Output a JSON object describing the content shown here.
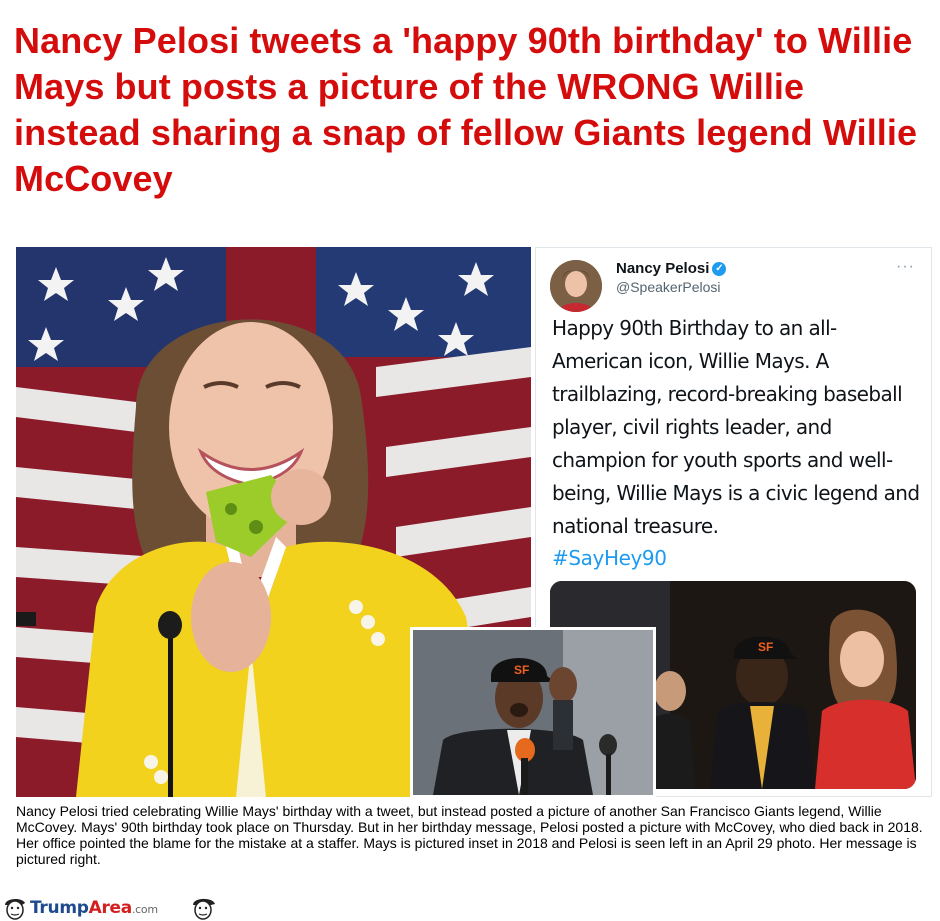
{
  "headline": "Nancy Pelosi tweets a 'happy 90th birthday' to Willie Mays but posts a picture of the WRONG Willie instead sharing a snap of fellow Giants legend Willie McCovey",
  "tweet": {
    "name": "Nancy Pelosi",
    "handle": "@SpeakerPelosi",
    "more": "···",
    "text": "Happy 90th Birthday to an all-American icon, Willie Mays. A trailblazing, record-breaking baseball player, civil rights leader, and champion for youth sports and well-being, Willie Mays is a civic legend and national treasure.",
    "hashtag": "#SayHey90"
  },
  "caption": "Nancy Pelosi tried celebrating Willie Mays' birthday with a tweet, but instead posted a picture of another San Francisco Giants legend, Willie McCovey. Mays' 90th birthday took place on Thursday. But in her birthday message, Pelosi posted a picture with McCovey, who died back in 2018. Her office pointed the blame for the mistake at a staffer. Mays is pictured inset in 2018 and Pelosi is seen left in an April 29 photo. Her message is pictured right.",
  "footer": {
    "brand_part1": "Trump",
    "brand_part2": "Area",
    "brand_part3": ".com"
  },
  "icons": {
    "verified": "verified-badge-icon",
    "more": "more-options-icon"
  },
  "colors": {
    "headline": "#d50c0c",
    "link": "#1d9bf0",
    "yellow_jacket": "#f2d21c"
  }
}
